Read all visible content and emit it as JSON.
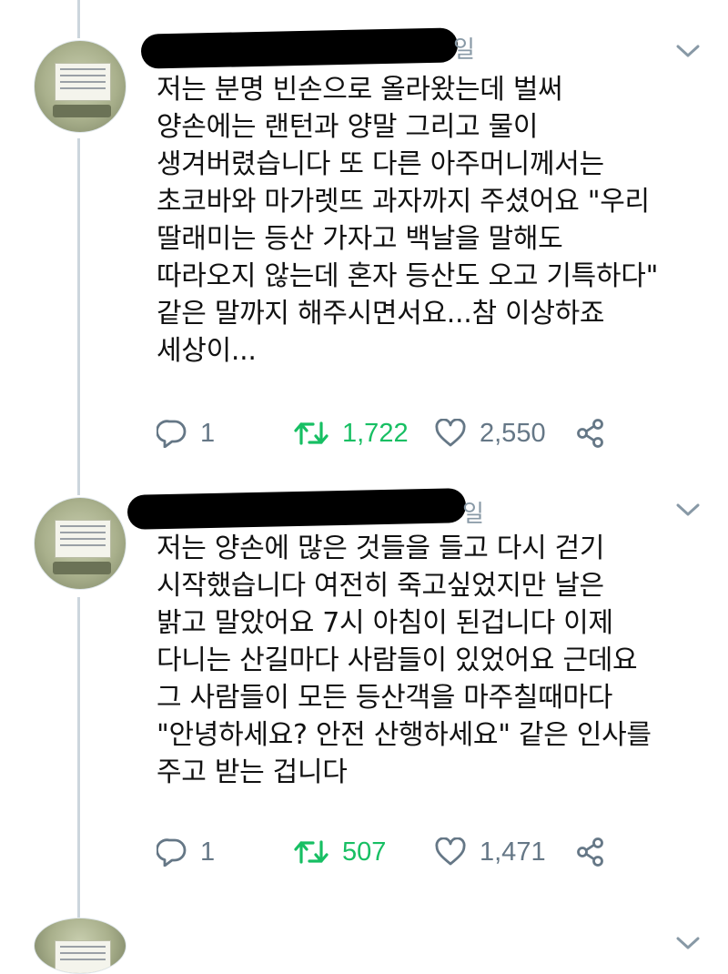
{
  "tweets": [
    {
      "name_visible_fragment": "일",
      "text": "저는 분명 빈손으로 올라왔는데 벌써\n양손에는 랜턴과 양말 그리고 물이\n생겨버렸습니다 또 다른 아주머니께서는\n초코바와 마가렛뜨 과자까지 주셨어요 \"우리\n딸래미는 등산 가자고 백날을 말해도\n따라오지 않는데 혼자 등산도 오고 기특하다\"\n같은 말까지 해주시면서요...참 이상하죠\n세상이...",
      "replies": "1",
      "retweets": "1,722",
      "likes": "2,550"
    },
    {
      "name_visible_fragment": "일",
      "text": "저는 양손에 많은 것들을 들고 다시 걷기\n시작했습니다 여전히 죽고싶었지만 날은\n밝고 말았어요 7시 아침이 된겁니다 이제\n다니는 산길마다 사람들이 있었어요 근데요\n그 사람들이 모든 등산객을 마주칠때마다\n\"안녕하세요? 안전 산행하세요\" 같은 인사를\n주고 받는 겁니다",
      "replies": "1",
      "retweets": "507",
      "likes": "1,471"
    }
  ],
  "colors": {
    "text": "#111111",
    "muted": "#657786",
    "retweet_active": "#17bf63",
    "thread_line": "#ccd6dd",
    "redaction": "#000000"
  },
  "icons": [
    "reply-icon",
    "retweet-icon",
    "like-icon",
    "share-icon",
    "chevron-down-icon"
  ]
}
